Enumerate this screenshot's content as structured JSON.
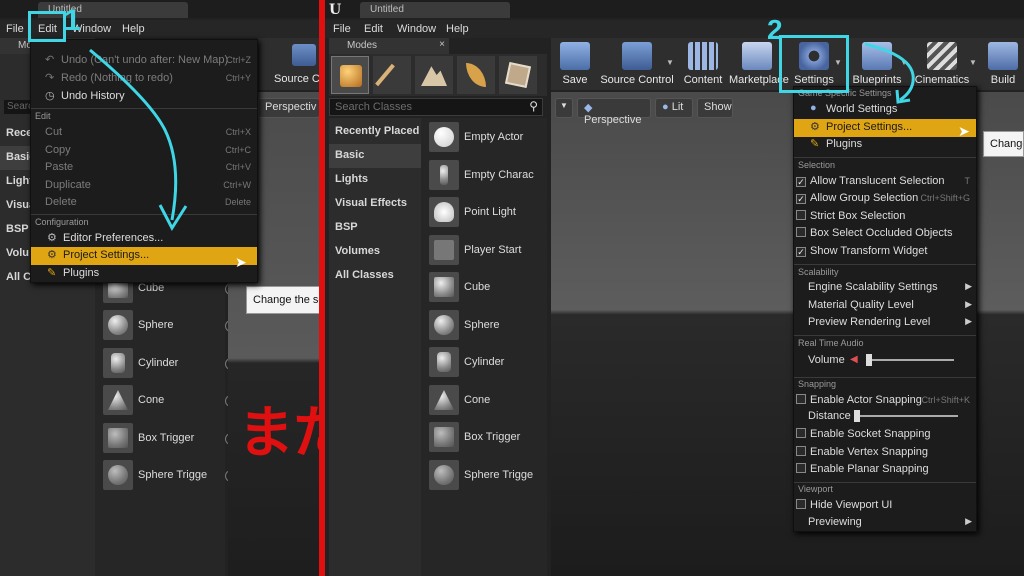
{
  "left": {
    "tab_title": "Untitled",
    "menubar": [
      "File",
      "Edit",
      "Window",
      "Help"
    ],
    "modes_label": "Mode",
    "search_placeholder": "Searc",
    "categories": [
      "Rece",
      "Basic",
      "Light",
      "Visua",
      "BSP",
      "Volu",
      "All Cl"
    ],
    "toolbar_label": "Source Co",
    "viewport_label": "Perspectiv",
    "items": [
      "Cube",
      "Sphere",
      "Cylinder",
      "Cone",
      "Box Trigger",
      "Sphere Trigge"
    ],
    "tooltip": "Change the set",
    "edit_menu": {
      "undo": "Undo (Can't undo after: New Map)",
      "undo_sc": "Ctrl+Z",
      "redo": "Redo (Nothing to redo)",
      "redo_sc": "Ctrl+Y",
      "history": "Undo History",
      "section_edit": "Edit",
      "cut": "Cut",
      "cut_sc": "Ctrl+X",
      "copy": "Copy",
      "copy_sc": "Ctrl+C",
      "paste": "Paste",
      "paste_sc": "Ctrl+V",
      "duplicate": "Duplicate",
      "duplicate_sc": "Ctrl+W",
      "delete": "Delete",
      "delete_sc": "Delete",
      "section_config": "Configuration",
      "editor_prefs": "Editor Preferences...",
      "project_settings": "Project Settings...",
      "plugins": "Plugins"
    },
    "annotation_number": "1",
    "handwriting": "または"
  },
  "right": {
    "tab_title": "Untitled",
    "menubar": [
      "File",
      "Edit",
      "Window",
      "Help"
    ],
    "modes_label": "Modes",
    "search_placeholder": "Search Classes",
    "categories": [
      "Recently Placed",
      "Basic",
      "Lights",
      "Visual Effects",
      "BSP",
      "Volumes",
      "All Classes"
    ],
    "items": [
      "Empty Actor",
      "Empty Charac",
      "Point Light",
      "Player Start",
      "Cube",
      "Sphere",
      "Cylinder",
      "Cone",
      "Box Trigger",
      "Sphere Trigge"
    ],
    "toolbar": [
      "Save",
      "Source Control",
      "Content",
      "Marketplace",
      "Settings",
      "Blueprints",
      "Cinematics",
      "Build"
    ],
    "viewport": {
      "perspective": "Perspective",
      "lit": "Lit",
      "show": "Show"
    },
    "tooltip": "Change",
    "annotation_number": "2",
    "settings_menu": {
      "section_project": "Game Specific Settings",
      "world": "World Settings",
      "project": "Project Settings...",
      "plugins": "Plugins",
      "section_selection": "Selection",
      "allow_translucent": "Allow Translucent Selection",
      "allow_translucent_sc": "T",
      "allow_group": "Allow Group Selection",
      "allow_group_sc": "Ctrl+Shift+G",
      "strict_box": "Strict Box Selection",
      "box_occluded": "Box Select Occluded Objects",
      "show_transform": "Show Transform Widget",
      "section_scalability": "Scalability",
      "engine_scal": "Engine Scalability Settings",
      "material_quality": "Material Quality Level",
      "preview_render": "Preview Rendering Level",
      "section_audio": "Real Time Audio",
      "volume": "Volume",
      "section_snapping": "Snapping",
      "actor_snap": "Enable Actor Snapping",
      "actor_snap_sc": "Ctrl+Shift+K",
      "distance": "Distance",
      "socket_snap": "Enable Socket Snapping",
      "vertex_snap": "Enable Vertex Snapping",
      "planar_snap": "Enable Planar Snapping",
      "section_viewport": "Viewport",
      "hide_ui": "Hide Viewport UI",
      "previewing": "Previewing"
    }
  },
  "colors": {
    "highlight": "#e0a512",
    "annotation": "#3fd6e6",
    "divider": "#e01010",
    "handwriting": "#e01010"
  }
}
